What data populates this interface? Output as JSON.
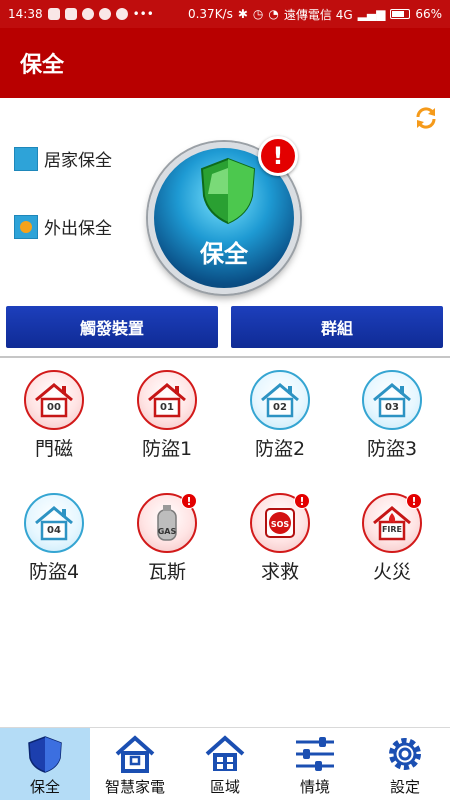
{
  "status_bar": {
    "time": "14:38",
    "speed": "0.37K/s",
    "carrier": "遠傳電信 4G",
    "battery": "66%"
  },
  "header": {
    "title": "保全"
  },
  "modes": {
    "home": "居家保全",
    "away": "外出保全"
  },
  "main_button": {
    "label": "保全",
    "alert": "!"
  },
  "actions": {
    "trigger_devices": "觸發裝置",
    "groups": "群組"
  },
  "devices": [
    {
      "name": "門磁",
      "code": "00",
      "style": "red"
    },
    {
      "name": "防盜1",
      "code": "01",
      "style": "red"
    },
    {
      "name": "防盜2",
      "code": "02",
      "style": "blue"
    },
    {
      "name": "防盜3",
      "code": "03",
      "style": "blue"
    },
    {
      "name": "防盜4",
      "code": "04",
      "style": "blue"
    },
    {
      "name": "瓦斯",
      "code": "GAS",
      "style": "red",
      "badge": "!"
    },
    {
      "name": "求救",
      "code": "SOS",
      "style": "red",
      "badge": "!"
    },
    {
      "name": "火災",
      "code": "FIRE",
      "style": "red",
      "badge": "!"
    }
  ],
  "bottom_nav": [
    {
      "label": "保全",
      "icon": "shield-icon",
      "active": true
    },
    {
      "label": "智慧家電",
      "icon": "smart-home-icon"
    },
    {
      "label": "區域",
      "icon": "house-icon"
    },
    {
      "label": "情境",
      "icon": "sliders-icon"
    },
    {
      "label": "設定",
      "icon": "gear-icon"
    }
  ],
  "colors": {
    "header_red": "#b80000",
    "button_blue": "#1d3fbc",
    "active_tab": "#b4dcf6"
  }
}
